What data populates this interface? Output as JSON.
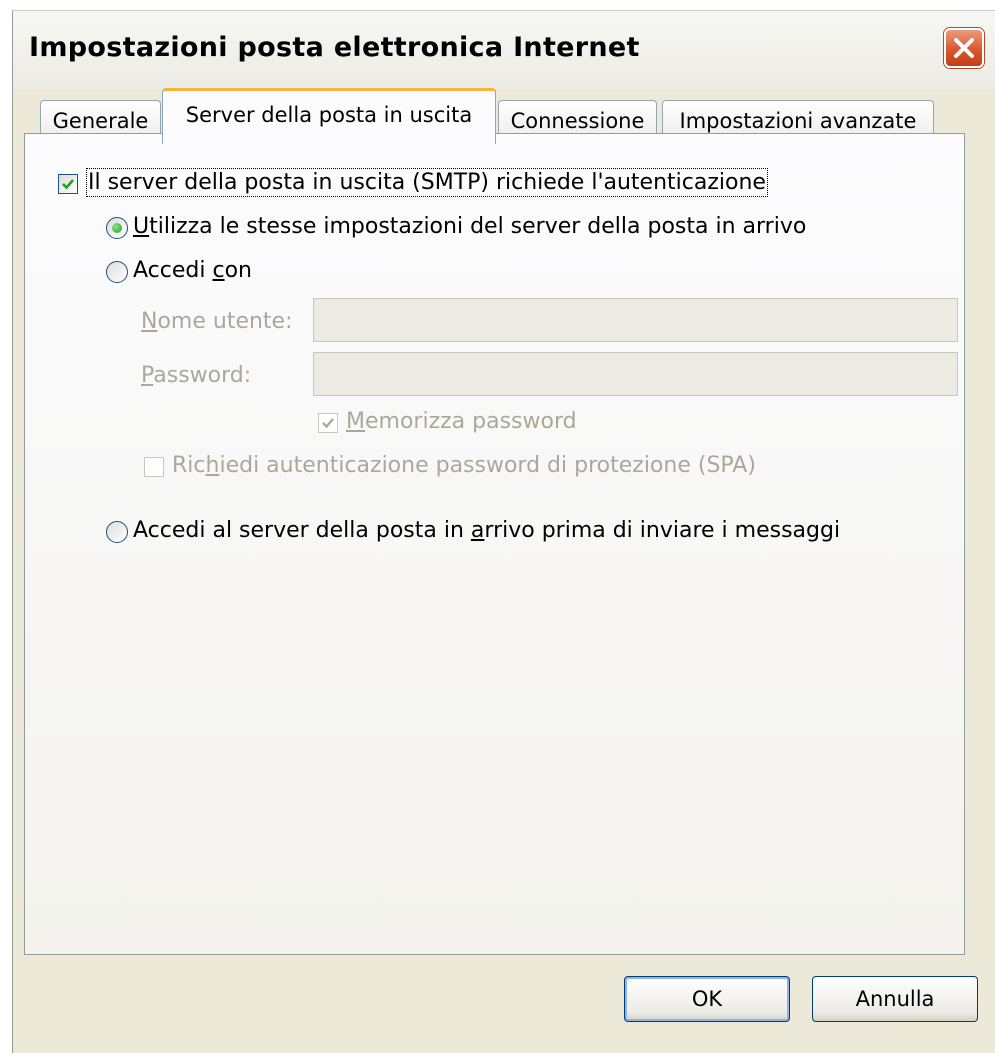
{
  "window": {
    "title": "Impostazioni posta elettronica Internet"
  },
  "tabs": [
    {
      "label": "Generale",
      "active": false
    },
    {
      "label": "Server della posta in uscita",
      "active": true
    },
    {
      "label": "Connessione",
      "active": false
    },
    {
      "label": "Impostazioni avanzate",
      "active": false
    }
  ],
  "smtp_auth": {
    "label": "Il server della posta in uscita (SMTP) richiede l'autenticazione",
    "checked": true
  },
  "options": {
    "same_settings": {
      "label": "tilizza le stesse impostazioni del server della posta in arrivo",
      "mnemonic": "U",
      "selected": true
    },
    "login_with": {
      "label_pre": "Accedi ",
      "mnemonic": "c",
      "label_post": "on",
      "selected": false
    },
    "login_incoming_first": {
      "label_pre": "Accedi al server della posta in ",
      "mnemonic": "a",
      "label_post": "rrivo prima di inviare i messaggi",
      "selected": false
    }
  },
  "credentials": {
    "username_label": {
      "mnemonic": "N",
      "rest": "ome utente:"
    },
    "username_value": "",
    "password_label": {
      "mnemonic": "P",
      "rest": "assword:"
    },
    "password_value": "",
    "remember_password": {
      "mnemonic": "M",
      "rest": "emorizza password",
      "checked": true,
      "enabled": false
    },
    "spa": {
      "pre": "Ric",
      "mnemonic": "h",
      "post": "iedi autenticazione password di protezione (SPA)",
      "checked": false,
      "enabled": false
    }
  },
  "buttons": {
    "ok": "OK",
    "cancel": "Annulla"
  },
  "colors": {
    "accent_tab": "#f8b33a",
    "close_red": "#d9572f",
    "checkbox_green": "#21a121"
  }
}
